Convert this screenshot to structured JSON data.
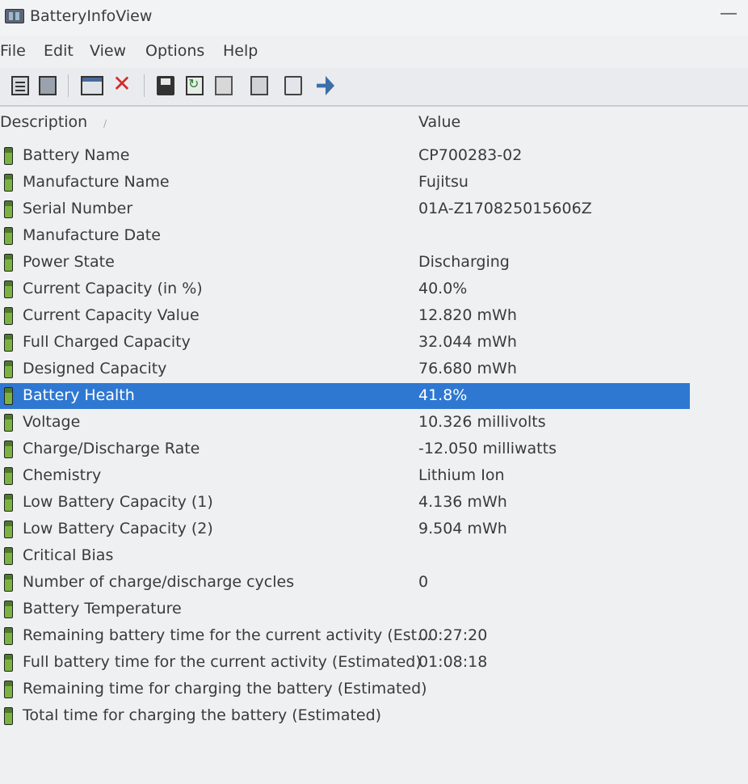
{
  "window": {
    "title": "BatteryInfoView"
  },
  "menu": [
    "File",
    "Edit",
    "View",
    "Options",
    "Help"
  ],
  "toolbar": {
    "icons": [
      "document-icon",
      "document-dark-icon",
      "window-icon",
      "delete-icon",
      "save-icon",
      "refresh-icon",
      "copy-icon",
      "properties-icon",
      "find-icon",
      "exit-icon"
    ]
  },
  "columns": {
    "description": "Description",
    "value": "Value"
  },
  "rows": [
    {
      "description": "Battery Name",
      "value": "CP700283-02"
    },
    {
      "description": "Manufacture Name",
      "value": "Fujitsu"
    },
    {
      "description": "Serial Number",
      "value": "01A-Z170825015606Z"
    },
    {
      "description": "Manufacture Date",
      "value": ""
    },
    {
      "description": "Power State",
      "value": "Discharging"
    },
    {
      "description": "Current Capacity (in %)",
      "value": "40.0%"
    },
    {
      "description": "Current Capacity Value",
      "value": "12.820 mWh"
    },
    {
      "description": "Full Charged Capacity",
      "value": "32.044 mWh"
    },
    {
      "description": "Designed Capacity",
      "value": "76.680 mWh"
    },
    {
      "description": "Battery Health",
      "value": "41.8%",
      "selected": true
    },
    {
      "description": "Voltage",
      "value": "10.326 millivolts"
    },
    {
      "description": "Charge/Discharge Rate",
      "value": "-12.050 milliwatts"
    },
    {
      "description": "Chemistry",
      "value": "Lithium Ion"
    },
    {
      "description": "Low Battery Capacity (1)",
      "value": "4.136 mWh"
    },
    {
      "description": "Low Battery Capacity (2)",
      "value": "9.504 mWh"
    },
    {
      "description": "Critical Bias",
      "value": ""
    },
    {
      "description": "Number of charge/discharge cycles",
      "value": "0"
    },
    {
      "description": "Battery Temperature",
      "value": ""
    },
    {
      "description": "Remaining battery time for the current activity (Est...",
      "value": "00:27:20"
    },
    {
      "description": "Full battery time for the current activity (Estimated)",
      "value": "01:08:18"
    },
    {
      "description": "Remaining time for charging the battery (Estimated)",
      "value": ""
    },
    {
      "description": "Total  time for charging the battery (Estimated)",
      "value": ""
    }
  ],
  "colors": {
    "selection": "#2f78d2",
    "battery_icon": "#7bb341"
  }
}
